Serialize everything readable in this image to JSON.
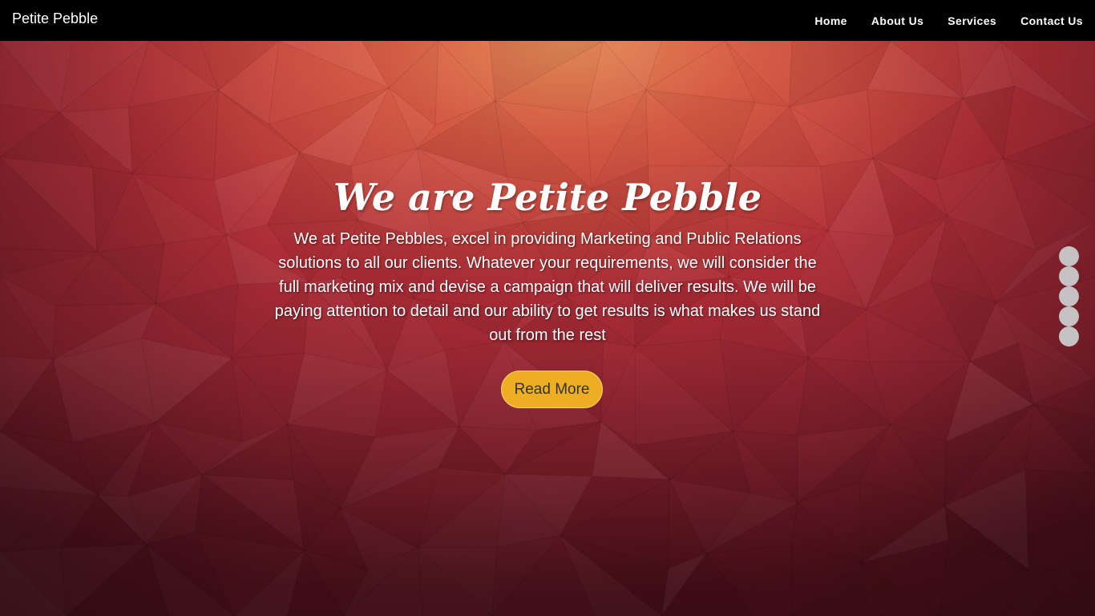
{
  "navbar": {
    "brand": "Petite Pebble",
    "links": [
      "Home",
      "About Us",
      "Services",
      "Contact Us"
    ]
  },
  "hero": {
    "title": "We are Petite Pebble",
    "text": "We at Petite Pebbles, excel in providing Marketing and Public Relations solutions to all our clients. Whatever your requirements, we will consider the full marketing mix and devise a campaign that will deliver results. We will be paying attention to detail and our ability to get results is what makes us stand out from the rest",
    "button_label": "Read More"
  },
  "slide_dots_count": 5,
  "colors": {
    "navbar": "#000000",
    "hero_top": "#e07a4a",
    "hero_mid": "#b8323a",
    "hero_bottom": "#5e1520",
    "button": "#eeae21",
    "dot": "#c4c2c3"
  }
}
